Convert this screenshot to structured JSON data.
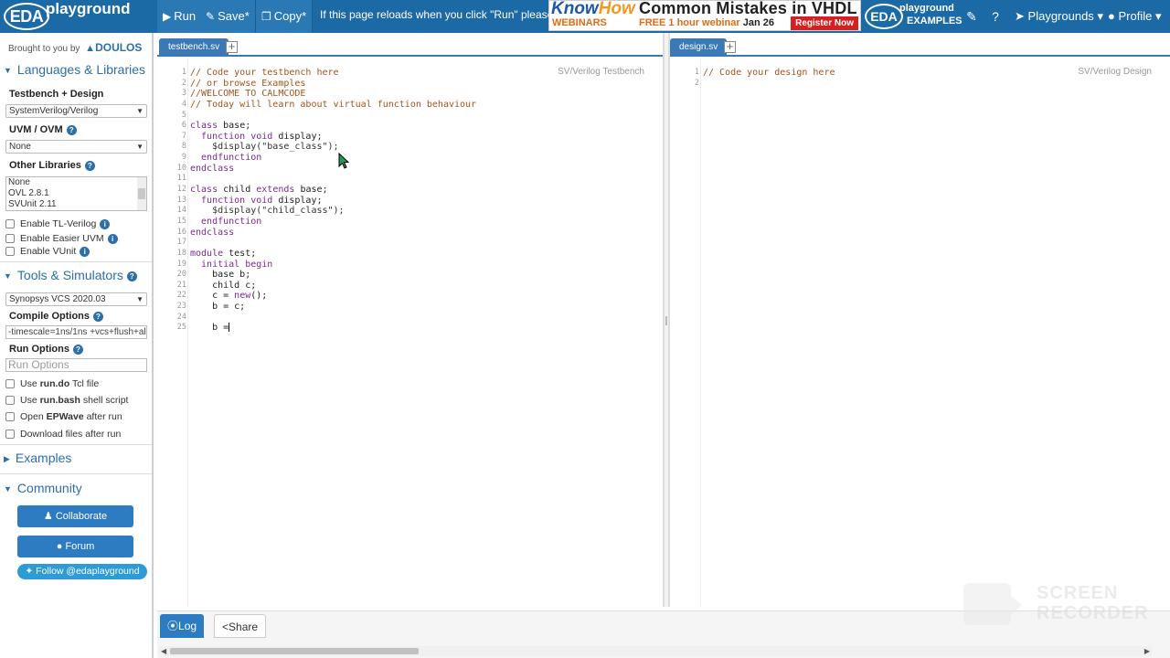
{
  "navbar": {
    "logo_eda": "EDA",
    "logo_playground": "playground",
    "run_label": "Run",
    "save_label": "Save",
    "copy_label": "Copy",
    "message": "If this page reloads when you click \"Run\" please read",
    "ad": {
      "brand_know": "Know",
      "brand_how": "How",
      "brand_sub": "WEBINARS",
      "headline": "Common Mistakes in VHDL",
      "offer": "FREE 1 hour webinar",
      "date": "Jan 26",
      "cta": "Register Now"
    },
    "examples_logo_eda": "EDA",
    "examples_logo_playground": "playground",
    "examples_logo_examples": "EXAMPLES",
    "playgrounds_label": "Playgrounds",
    "profile_label": "Profile"
  },
  "sidebar": {
    "brought_by": "Brought to you by",
    "sponsor": "DOULOS",
    "languages_section": "Languages & Libraries",
    "testbench_design_label": "Testbench + Design",
    "language_value": "SystemVerilog/Verilog",
    "uvm_label": "UVM / OVM",
    "uvm_value": "None",
    "other_libraries_label": "Other Libraries",
    "other_libraries": [
      "None",
      "OVL 2.8.1",
      "SVUnit 2.11"
    ],
    "checks_libs": [
      "Enable TL-Verilog",
      "Enable Easier UVM",
      "Enable VUnit"
    ],
    "tools_section": "Tools & Simulators",
    "simulator_value": "Synopsys VCS 2020.03",
    "compile_options_label": "Compile Options",
    "compile_options_value": "-timescale=1ns/1ns +vcs+flush+all",
    "run_options_label": "Run Options",
    "run_options_placeholder": "Run Options",
    "run_checks": [
      {
        "pre": "Use ",
        "bold": "run.do",
        "post": " Tcl file"
      },
      {
        "pre": "Use ",
        "bold": "run.bash",
        "post": " shell script"
      },
      {
        "pre": "Open ",
        "bold": "EPWave",
        "post": " after run"
      },
      {
        "pre": "Download files after run",
        "bold": "",
        "post": ""
      }
    ],
    "examples_section": "Examples",
    "community_section": "Community",
    "collaborate_label": "Collaborate",
    "forum_label": "Forum",
    "follow_label": "Follow @edaplayground"
  },
  "left_editor": {
    "tab": "testbench.sv",
    "lang_label": "SV/Verilog Testbench",
    "line_numbers": [
      "1",
      "2",
      "3",
      "4",
      "5",
      "6",
      "7",
      "8",
      "9",
      "10",
      "11",
      "12",
      "13",
      "14",
      "15",
      "16",
      "17",
      "18",
      "19",
      "20",
      "21",
      "22",
      "23",
      "24",
      "25"
    ],
    "lines": [
      [
        {
          "t": "// Code your testbench here",
          "c": "cm-c"
        }
      ],
      [
        {
          "t": "// or browse Examples",
          "c": "cm-c"
        }
      ],
      [
        {
          "t": "//WELCOME TO CALMCODE",
          "c": "cm-c"
        }
      ],
      [
        {
          "t": "// Today will learn about virtual function behaviour",
          "c": "cm-c"
        }
      ],
      [
        {
          "t": "",
          "c": ""
        }
      ],
      [
        {
          "t": "class",
          "c": "cm-k"
        },
        {
          "t": " base;",
          "c": ""
        }
      ],
      [
        {
          "t": "  function void",
          "c": "cm-k"
        },
        {
          "t": " display;",
          "c": ""
        }
      ],
      [
        {
          "t": "    $display(\"base_class\");",
          "c": "cm-s"
        }
      ],
      [
        {
          "t": "  endfunction",
          "c": "cm-k"
        }
      ],
      [
        {
          "t": "endclass",
          "c": "cm-k"
        }
      ],
      [
        {
          "t": "",
          "c": ""
        }
      ],
      [
        {
          "t": "class",
          "c": "cm-k"
        },
        {
          "t": " child ",
          "c": ""
        },
        {
          "t": "extends",
          "c": "cm-k"
        },
        {
          "t": " base;",
          "c": ""
        }
      ],
      [
        {
          "t": "  function void",
          "c": "cm-k"
        },
        {
          "t": " display;",
          "c": ""
        }
      ],
      [
        {
          "t": "    $display(\"child_class\");",
          "c": "cm-s"
        }
      ],
      [
        {
          "t": "  endfunction",
          "c": "cm-k"
        }
      ],
      [
        {
          "t": "endclass",
          "c": "cm-k"
        }
      ],
      [
        {
          "t": "",
          "c": ""
        }
      ],
      [
        {
          "t": "module",
          "c": "cm-k"
        },
        {
          "t": " test;",
          "c": ""
        }
      ],
      [
        {
          "t": "  initial begin",
          "c": "cm-k"
        }
      ],
      [
        {
          "t": "    base b;",
          "c": ""
        }
      ],
      [
        {
          "t": "    child c;",
          "c": ""
        }
      ],
      [
        {
          "t": "    c = ",
          "c": ""
        },
        {
          "t": "new",
          "c": "cm-k"
        },
        {
          "t": "();",
          "c": ""
        }
      ],
      [
        {
          "t": "    b = c;",
          "c": ""
        }
      ],
      [
        {
          "t": "",
          "c": ""
        }
      ],
      [
        {
          "t": "    b =",
          "c": ""
        }
      ]
    ]
  },
  "right_editor": {
    "tab": "design.sv",
    "lang_label": "SV/Verilog Design",
    "line_numbers": [
      "1",
      "2"
    ],
    "lines": [
      [
        {
          "t": "// Code your design here",
          "c": "cm-c"
        }
      ],
      [
        {
          "t": "",
          "c": ""
        }
      ]
    ]
  },
  "bottom": {
    "log_label": "Log",
    "share_label": "Share"
  },
  "watermark": {
    "line1": "SCREEN",
    "line2": "RECORDER"
  }
}
